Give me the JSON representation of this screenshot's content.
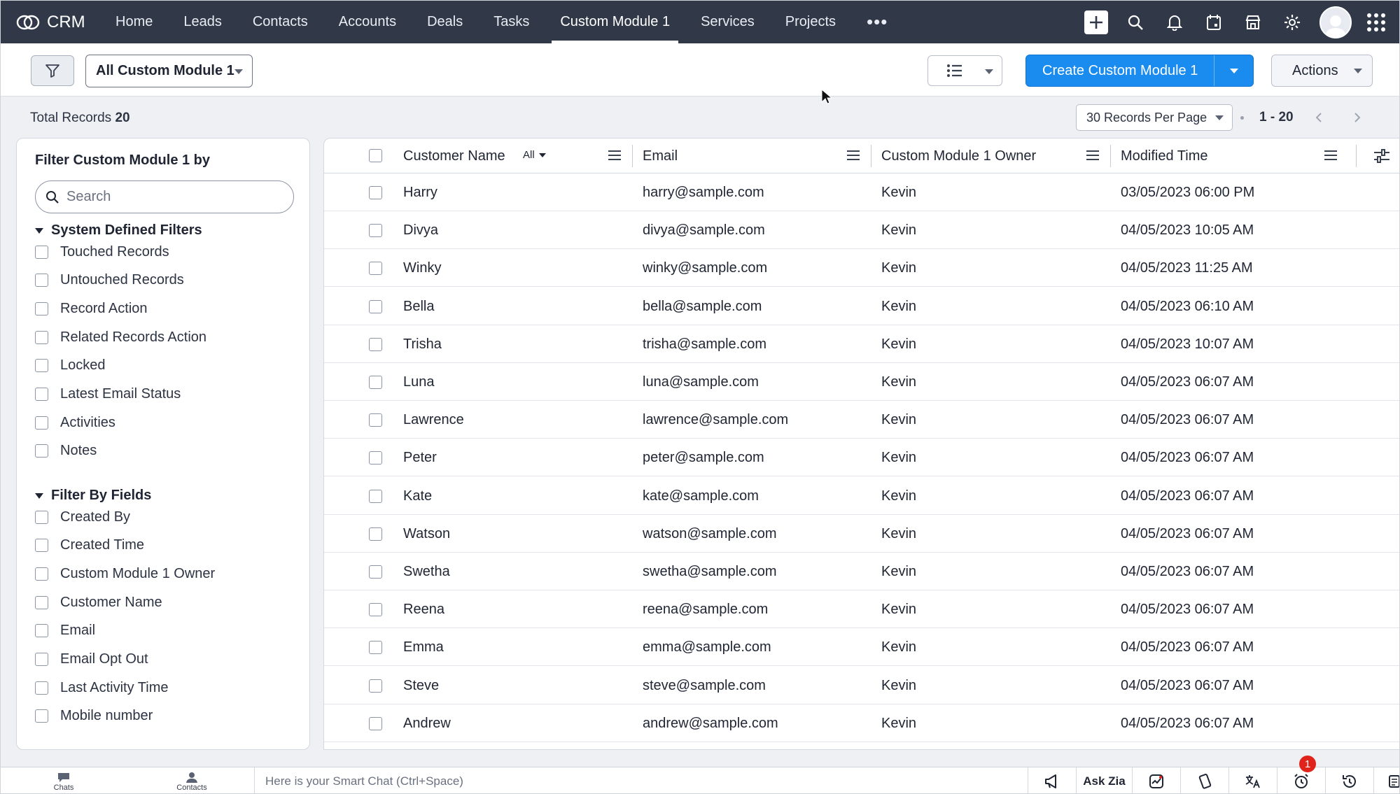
{
  "app": {
    "logo_text": "CRM"
  },
  "nav": {
    "tabs": [
      {
        "label": "Home"
      },
      {
        "label": "Leads"
      },
      {
        "label": "Contacts"
      },
      {
        "label": "Accounts"
      },
      {
        "label": "Deals"
      },
      {
        "label": "Tasks"
      },
      {
        "label": "Custom Module 1",
        "active": true
      },
      {
        "label": "Services"
      },
      {
        "label": "Projects"
      }
    ],
    "more_label": "•••"
  },
  "toolbar": {
    "view_select": "All Custom Module 1",
    "create_button": "Create Custom Module 1",
    "actions_button": "Actions"
  },
  "records": {
    "total_label": "Total Records",
    "total_count": "20",
    "per_page": "30 Records Per Page",
    "page_range": "1 - 20"
  },
  "sidebar": {
    "title": "Filter Custom Module 1 by",
    "search_placeholder": "Search",
    "system_section": "System Defined Filters",
    "system_filters": [
      "Touched Records",
      "Untouched Records",
      "Record Action",
      "Related Records Action",
      "Locked",
      "Latest Email Status",
      "Activities",
      "Notes"
    ],
    "fields_section": "Filter By Fields",
    "field_filters": [
      "Created By",
      "Created Time",
      "Custom Module 1 Owner",
      "Customer Name",
      "Email",
      "Email Opt Out",
      "Last Activity Time",
      "Mobile number"
    ]
  },
  "table": {
    "columns": {
      "name": "Customer Name",
      "name_filter": "All",
      "email": "Email",
      "owner": "Custom Module 1 Owner",
      "modified": "Modified Time"
    },
    "rows": [
      {
        "name": "Harry",
        "email": "harry@sample.com",
        "owner": "Kevin",
        "modified": "03/05/2023 06:00 PM"
      },
      {
        "name": "Divya",
        "email": "divya@sample.com",
        "owner": "Kevin",
        "modified": "04/05/2023 10:05 AM"
      },
      {
        "name": "Winky",
        "email": "winky@sample.com",
        "owner": "Kevin",
        "modified": "04/05/2023 11:25 AM"
      },
      {
        "name": "Bella",
        "email": "bella@sample.com",
        "owner": "Kevin",
        "modified": "04/05/2023 06:10 AM"
      },
      {
        "name": "Trisha",
        "email": "trisha@sample.com",
        "owner": "Kevin",
        "modified": "04/05/2023 10:07 AM"
      },
      {
        "name": "Luna",
        "email": "luna@sample.com",
        "owner": "Kevin",
        "modified": "04/05/2023 06:07 AM"
      },
      {
        "name": "Lawrence",
        "email": "lawrence@sample.com",
        "owner": "Kevin",
        "modified": "04/05/2023 06:07 AM"
      },
      {
        "name": "Peter",
        "email": "peter@sample.com",
        "owner": "Kevin",
        "modified": "04/05/2023 06:07 AM"
      },
      {
        "name": "Kate",
        "email": "kate@sample.com",
        "owner": "Kevin",
        "modified": "04/05/2023 06:07 AM"
      },
      {
        "name": "Watson",
        "email": "watson@sample.com",
        "owner": "Kevin",
        "modified": "04/05/2023 06:07 AM"
      },
      {
        "name": "Swetha",
        "email": "swetha@sample.com",
        "owner": "Kevin",
        "modified": "04/05/2023 06:07 AM"
      },
      {
        "name": "Reena",
        "email": "reena@sample.com",
        "owner": "Kevin",
        "modified": "04/05/2023 06:07 AM"
      },
      {
        "name": "Emma",
        "email": "emma@sample.com",
        "owner": "Kevin",
        "modified": "04/05/2023 06:07 AM"
      },
      {
        "name": "Steve",
        "email": "steve@sample.com",
        "owner": "Kevin",
        "modified": "04/05/2023 06:07 AM"
      },
      {
        "name": "Andrew",
        "email": "andrew@sample.com",
        "owner": "Kevin",
        "modified": "04/05/2023 06:07 AM"
      }
    ]
  },
  "bottom": {
    "chats_label": "Chats",
    "contacts_label": "Contacts",
    "smart_chat_placeholder": "Here is your Smart Chat (Ctrl+Space)",
    "ask_zia": "Ask Zia",
    "alarm_badge": "1"
  },
  "colors": {
    "nav_bg": "#313949",
    "primary": "#1a8cf0",
    "badge": "#e0241b"
  },
  "icons": {
    "nav_right": [
      "plus-icon",
      "search-icon",
      "bell-icon",
      "calendar-icon",
      "store-icon",
      "gear-icon",
      "avatar",
      "apps-grid-icon"
    ],
    "bottom_right": [
      "megaphone-icon",
      "ask-zia",
      "zia-chart-icon",
      "mobile-icon",
      "translate-icon",
      "alarm-icon",
      "history-icon",
      "notes-icon"
    ]
  }
}
